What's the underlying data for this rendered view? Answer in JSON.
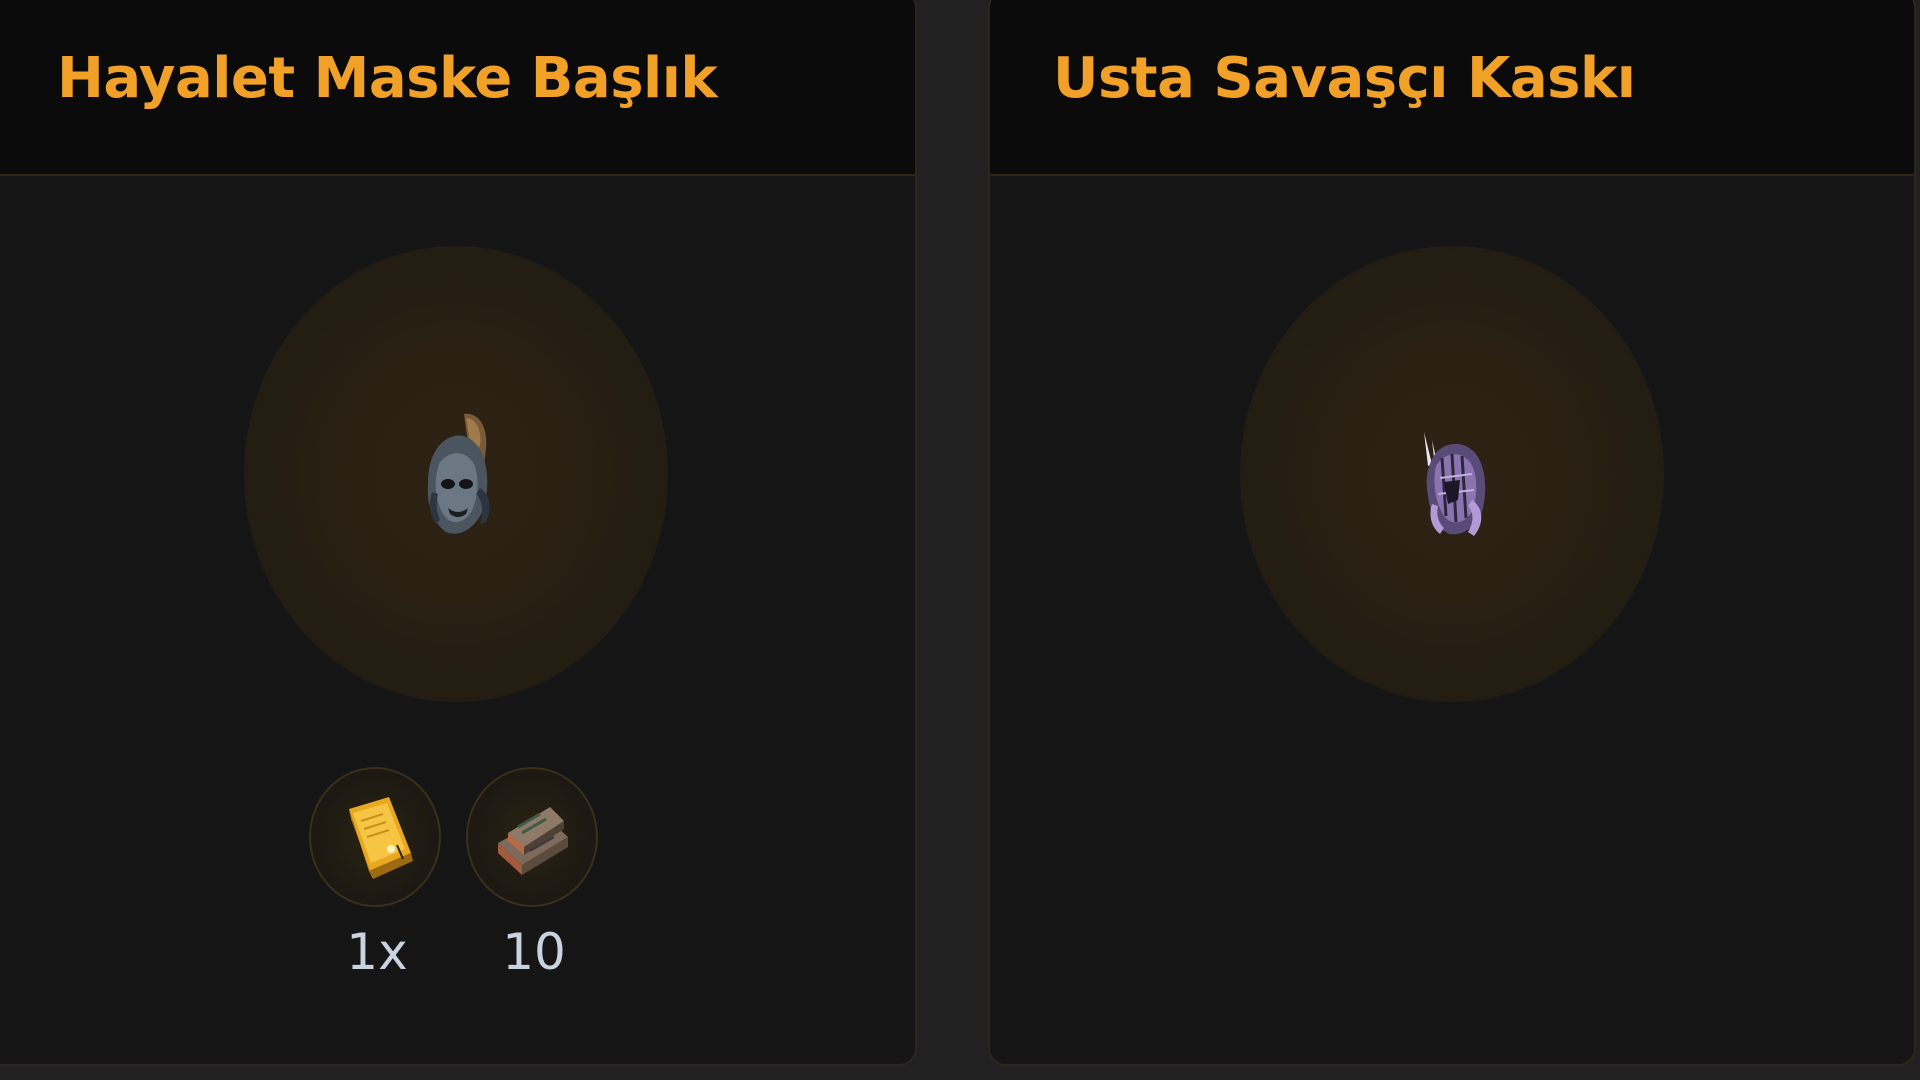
{
  "cards": [
    {
      "title": "Hayalet Maske Başlık",
      "item_icon": "dark-mask-helmet-icon",
      "requirements": [
        {
          "icon": "golden-book-icon",
          "count": "1x"
        },
        {
          "icon": "stacked-books-icon",
          "count": "10"
        }
      ]
    },
    {
      "title": "Usta Savaşçı Kaskı",
      "item_icon": "purple-warrior-helmet-icon",
      "requirements": []
    }
  ],
  "colors": {
    "background": "#212121",
    "card": "#151515",
    "header": "#0b0b0b",
    "title": "#f2a128",
    "count_text": "#c9d3df"
  }
}
